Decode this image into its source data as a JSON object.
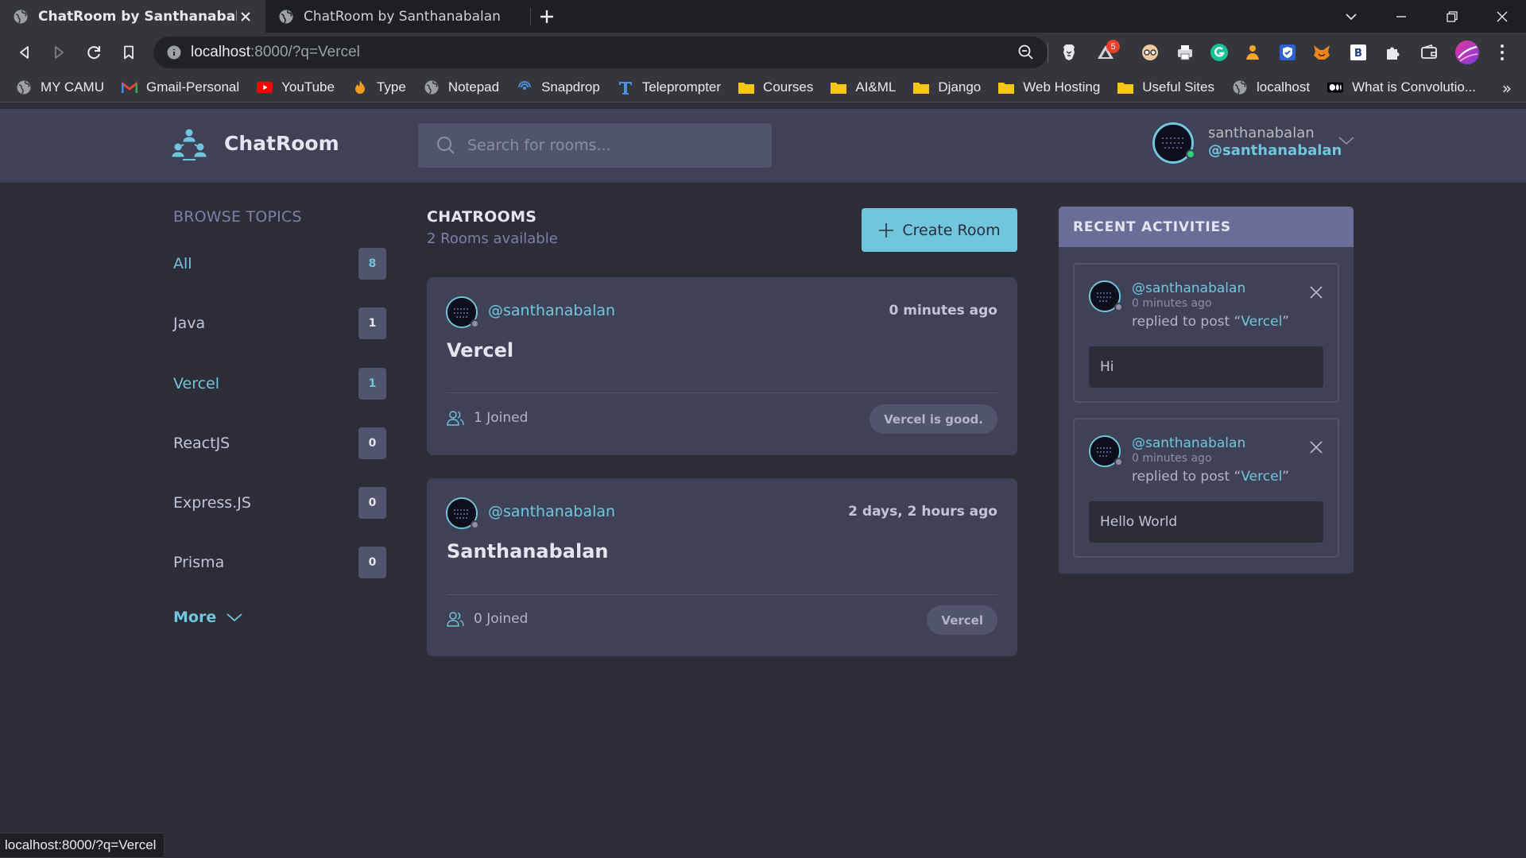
{
  "browser": {
    "tabs": [
      {
        "title": "ChatRoom by Santhanabalan",
        "active": true
      },
      {
        "title": "ChatRoom by Santhanabalan",
        "active": false
      }
    ],
    "url_host": "localhost",
    "url_rest": ":8000/?q=Vercel",
    "brave_badge": "5",
    "bookmarks": [
      {
        "label": "MY CAMU",
        "icon": "globe-icon"
      },
      {
        "label": "Gmail-Personal",
        "icon": "gmail-icon"
      },
      {
        "label": "YouTube",
        "icon": "youtube-icon"
      },
      {
        "label": "Type",
        "icon": "fire-icon"
      },
      {
        "label": "Notepad",
        "icon": "globe-icon"
      },
      {
        "label": "Snapdrop",
        "icon": "snapdrop-icon"
      },
      {
        "label": "Teleprompter",
        "icon": "t-icon"
      },
      {
        "label": "Courses",
        "icon": "folder-icon"
      },
      {
        "label": "AI&ML",
        "icon": "folder-icon"
      },
      {
        "label": "Django",
        "icon": "folder-icon"
      },
      {
        "label": "Web Hosting",
        "icon": "folder-icon"
      },
      {
        "label": "Useful Sites",
        "icon": "folder-icon"
      },
      {
        "label": "localhost",
        "icon": "globe-icon"
      },
      {
        "label": "What is Convolutio...",
        "icon": "medium-icon"
      }
    ],
    "bookmarks_more": "»",
    "status_url": "localhost:8000/?q=Vercel"
  },
  "header": {
    "brand": "ChatRoom",
    "search_placeholder": "Search for rooms...",
    "user_name": "santhanabalan",
    "user_handle": "@santhanabalan"
  },
  "topics": {
    "title": "BROWSE TOPICS",
    "items": [
      {
        "label": "All",
        "count": "8",
        "selected": true
      },
      {
        "label": "Java",
        "count": "1",
        "selected": false
      },
      {
        "label": "Vercel",
        "count": "1",
        "selected": true
      },
      {
        "label": "ReactJS",
        "count": "0",
        "selected": false
      },
      {
        "label": "Express.JS",
        "count": "0",
        "selected": false
      },
      {
        "label": "Prisma",
        "count": "0",
        "selected": false
      }
    ],
    "more_label": "More"
  },
  "rooms": {
    "title": "CHATROOMS",
    "subtitle": "2 Rooms available",
    "create_label": "Create Room",
    "items": [
      {
        "host": "@santhanabalan",
        "time": "0 minutes ago",
        "name": "Vercel",
        "joined": "1 Joined",
        "topic": "Vercel is good."
      },
      {
        "host": "@santhanabalan",
        "time": "2 days, 2 hours ago",
        "name": "Santhanabalan",
        "joined": "0 Joined",
        "topic": "Vercel"
      }
    ]
  },
  "activities": {
    "title": "RECENT ACTIVITIES",
    "items": [
      {
        "handle": "@santhanabalan",
        "time": "0 minutes ago",
        "action": "replied to post “",
        "post": "Vercel",
        "action_end": "”",
        "message": "Hi"
      },
      {
        "handle": "@santhanabalan",
        "time": "0 minutes ago",
        "action": "replied to post “",
        "post": "Vercel",
        "action_end": "”",
        "message": "Hello World"
      }
    ]
  },
  "colors": {
    "accent": "#71c6dd",
    "background": "#2d2d39",
    "card": "#3f4156",
    "activity_header": "#696d97"
  }
}
